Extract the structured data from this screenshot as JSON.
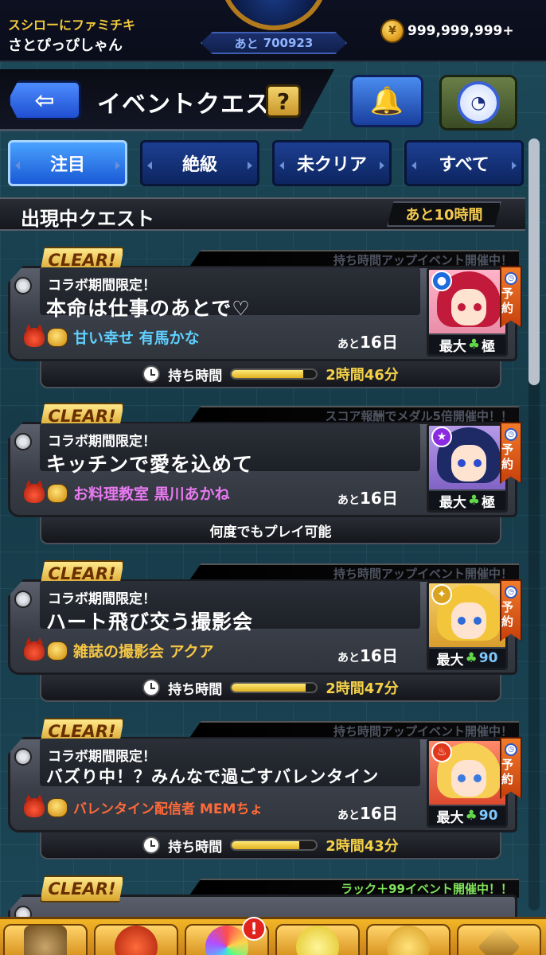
{
  "header": {
    "shop_text": "スシローにファミチキ",
    "username": "さとぴっぴしゃん",
    "remain_label": "あと",
    "remain_value": "700923",
    "coins": "999,999,999+"
  },
  "nav": {
    "page_title": "イベントクエスト",
    "help_label": "?"
  },
  "tabs": [
    {
      "label": "注目",
      "active": true
    },
    {
      "label": "絶級",
      "active": false
    },
    {
      "label": "未クリア",
      "active": false
    },
    {
      "label": "すべて",
      "active": false
    }
  ],
  "section": {
    "title": "出現中クエスト",
    "time_left": "あと10時間"
  },
  "quests": [
    {
      "badge": "CLEAR!",
      "event_ribbon": "持ち時間アップイベント開催中！",
      "subtitle": "コラボ期間限定！",
      "title": "本命は仕事のあとで♡",
      "boss_name": "甘い幸せ 有馬かな",
      "boss_color": "#5fd0ff",
      "days_prefix": "あと",
      "days_value": "16日",
      "level_label": "最大",
      "level_value": "極",
      "reserve_label": "予約",
      "footer_type": "time",
      "footer_label": "持ち時間",
      "footer_value": "2時間46分",
      "progress": 0.85
    },
    {
      "badge": "CLEAR!",
      "event_ribbon": "スコア報酬でメダル5倍開催中！！",
      "subtitle": "コラボ期間限定！",
      "title": "キッチンで愛を込めて",
      "boss_name": "お料理教室 黒川あかね",
      "boss_color": "#e879f0",
      "days_prefix": "あと",
      "days_value": "16日",
      "level_label": "最大",
      "level_value": "極",
      "reserve_label": "予約",
      "footer_type": "text",
      "footer_label": "何度でもプレイ可能"
    },
    {
      "badge": "CLEAR!",
      "event_ribbon": "持ち時間アップイベント開催中！",
      "subtitle": "コラボ期間限定！",
      "title": "ハート飛び交う撮影会",
      "boss_name": "雑誌の撮影会 アクア",
      "boss_color": "#f5c744",
      "days_prefix": "あと",
      "days_value": "16日",
      "level_label": "最大",
      "level_value": "90",
      "reserve_label": "予約",
      "footer_type": "time",
      "footer_label": "持ち時間",
      "footer_value": "2時間47分",
      "progress": 0.88
    },
    {
      "badge": "CLEAR!",
      "event_ribbon": "持ち時間アップイベント開催中！",
      "subtitle": "コラボ期間限定！",
      "title": "バズり中！？みんなで過ごすバレンタイン",
      "boss_name": "バレンタイン配信者 MEMちょ",
      "boss_color": "#ff6a3a",
      "days_prefix": "あと",
      "days_value": "16日",
      "level_label": "最大",
      "level_value": "90",
      "reserve_label": "予約",
      "footer_type": "time",
      "footer_label": "持ち時間",
      "footer_value": "2時間43分",
      "progress": 0.8
    },
    {
      "badge": "CLEAR!",
      "event_ribbon": "ラック＋99イベント開催中！！"
    }
  ],
  "bottom_nav": {
    "alert_label": "!",
    "icons": [
      "gate-icon",
      "monster-icon",
      "orb-icon",
      "egg-icon",
      "balloon-icon",
      "diamond-icon"
    ]
  }
}
